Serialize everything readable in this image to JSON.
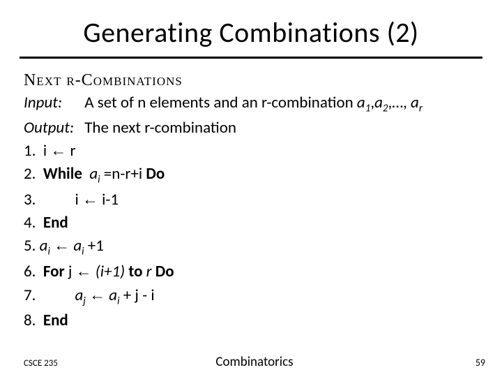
{
  "title": "Generating Combinations (2)",
  "algo_name": "Next r-Combinations",
  "input": {
    "label": "Input",
    "text_pre": "A set of n elements and an r-combination ",
    "seq": "a",
    "seq_subs": [
      "1",
      "2",
      "r"
    ],
    "ellipsis": ",…, "
  },
  "output": {
    "label": "Output",
    "text": "The next r-combination"
  },
  "steps": {
    "s1": {
      "num": "1.",
      "body": "i ",
      "arrow": "←",
      "after": " r"
    },
    "s2": {
      "num": "2.",
      "kw": "While",
      "var": "a",
      "sub": "i",
      "cond": " =n-r+i ",
      "do": "Do"
    },
    "s3": {
      "num": "3.",
      "body": "i ",
      "arrow": "←",
      "after": " i-1"
    },
    "s4": {
      "num": "4.",
      "kw": "End"
    },
    "s5": {
      "num": "5.",
      "lhs": "a",
      "lsub": "i",
      "arrow": "←",
      "rhs": " a",
      "rsub": "i",
      "tail": " +1"
    },
    "s6": {
      "num": "6.",
      "kw": "For",
      "var": " j ",
      "arrow": "←",
      "range": " (i+1) ",
      "to": "to",
      "rv": " r ",
      "do": "Do"
    },
    "s7": {
      "num": "7.",
      "lhs": "a",
      "lsub": "j",
      "arrow": "←",
      "rhs": " a",
      "rsub": "i",
      "tail": " + j - i"
    },
    "s8": {
      "num": "8.",
      "kw": "End"
    }
  },
  "footer": {
    "left": "CSCE 235",
    "center": "Combinatorics",
    "right": "59"
  }
}
